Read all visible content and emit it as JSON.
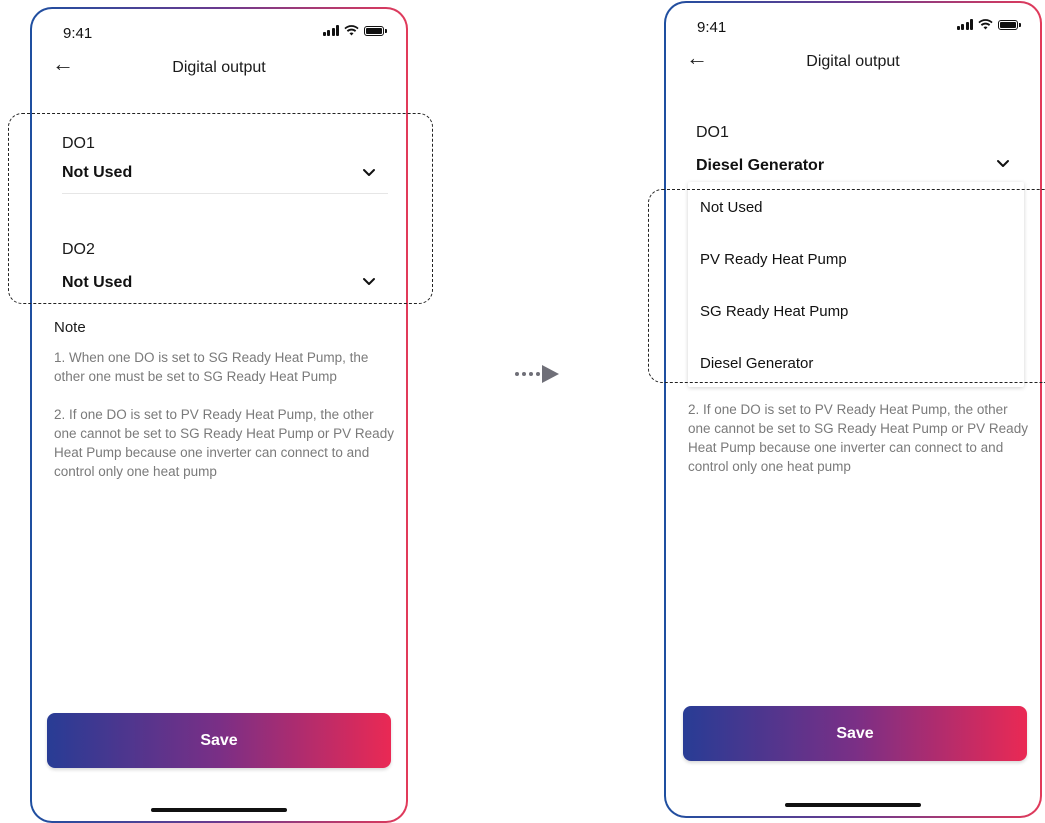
{
  "status": {
    "time": "9:41"
  },
  "header": {
    "title": "Digital output"
  },
  "left_screen": {
    "do1": {
      "label": "DO1",
      "value": "Not Used"
    },
    "do2": {
      "label": "DO2",
      "value": "Not Used"
    },
    "note": {
      "title": "Note",
      "items": [
        "1. When one DO is set to SG Ready Heat Pump, the other one must be set to SG Ready Heat Pump",
        "2. If one DO is set to PV Ready Heat Pump, the other one cannot be set to SG Ready Heat Pump or PV Ready Heat Pump because one inverter can connect to and control only one heat pump"
      ]
    },
    "save_label": "Save"
  },
  "right_screen": {
    "do1": {
      "label": "DO1",
      "value": "Diesel Generator"
    },
    "dropdown_options": [
      "Not Used",
      "PV Ready Heat Pump",
      "SG Ready Heat Pump",
      "Diesel Generator"
    ],
    "note_item": "2. If one DO is set to PV Ready Heat Pump, the other one cannot be set to SG Ready Heat Pump or PV Ready Heat Pump because one inverter can connect to and control only one heat pump",
    "save_label": "Save"
  },
  "colors": {
    "gradient_start": "#283c95",
    "gradient_mid": "#7a2f86",
    "gradient_end": "#ea2954",
    "note_text": "#7a7a7a"
  },
  "icons": [
    "back-arrow-icon",
    "chevron-down-icon",
    "signal-icon",
    "wifi-icon",
    "battery-icon",
    "transition-arrow-icon"
  ]
}
